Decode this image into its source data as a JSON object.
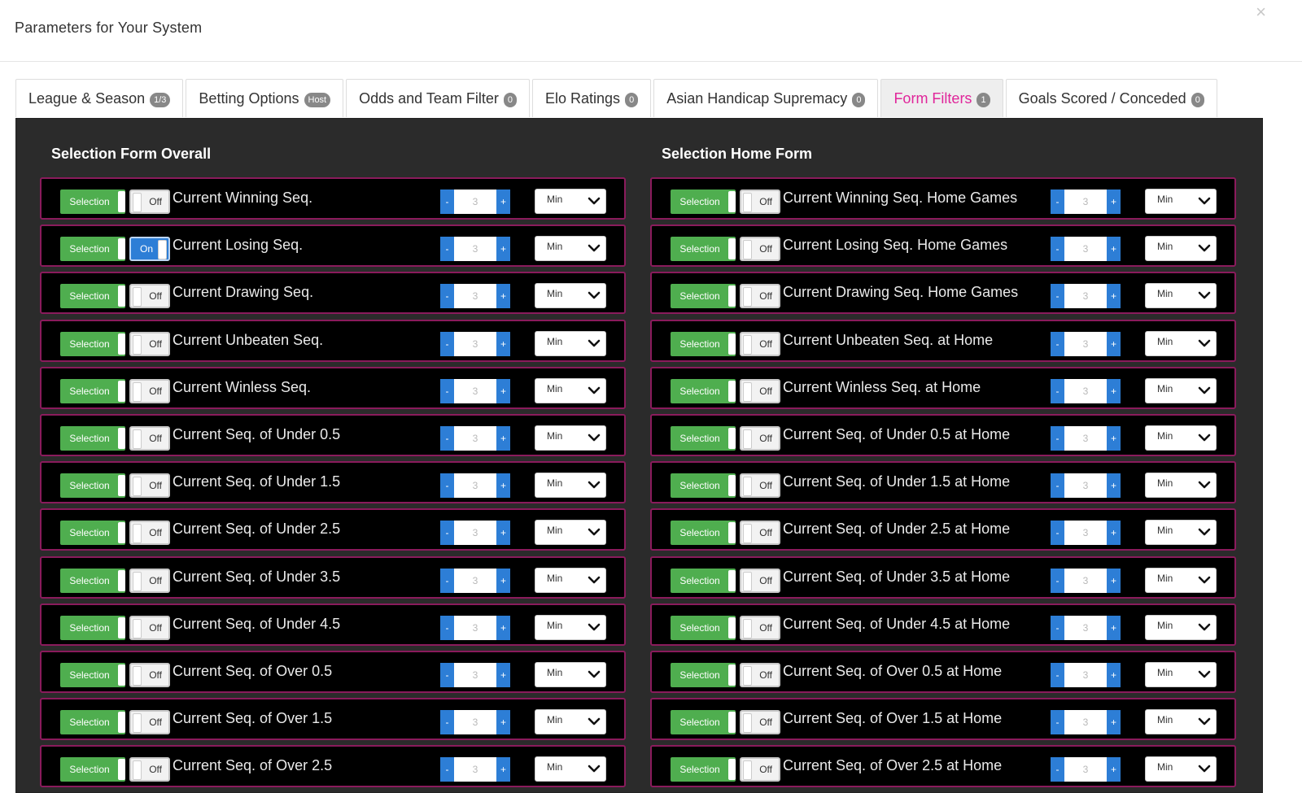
{
  "modal": {
    "title": "Parameters for Your System",
    "close": "×"
  },
  "tabs": [
    {
      "label": "League & Season",
      "badge": "1/3"
    },
    {
      "label": "Betting Options",
      "badge": "Host"
    },
    {
      "label": "Odds and Team Filter",
      "badge": "0"
    },
    {
      "label": "Elo Ratings",
      "badge": "0"
    },
    {
      "label": "Asian Handicap Supremacy",
      "badge": "0"
    },
    {
      "label": "Form Filters",
      "badge": "1",
      "active": true
    },
    {
      "label": "Goals Scored / Conceded",
      "badge": "0"
    }
  ],
  "left": {
    "title": "Selection Form Overall",
    "rows": [
      {
        "sel": "Selection",
        "toggle": "Off",
        "label": "Current Winning Seq.",
        "minus": "-",
        "value": "3",
        "plus": "+",
        "select": "Min"
      },
      {
        "sel": "Selection",
        "toggle": "On",
        "label": "Current Losing Seq.",
        "minus": "-",
        "value": "3",
        "plus": "+",
        "select": "Min"
      },
      {
        "sel": "Selection",
        "toggle": "Off",
        "label": "Current Drawing Seq.",
        "minus": "-",
        "value": "3",
        "plus": "+",
        "select": "Min"
      },
      {
        "sel": "Selection",
        "toggle": "Off",
        "label": "Current Unbeaten Seq.",
        "minus": "-",
        "value": "3",
        "plus": "+",
        "select": "Min"
      },
      {
        "sel": "Selection",
        "toggle": "Off",
        "label": "Current Winless Seq.",
        "minus": "-",
        "value": "3",
        "plus": "+",
        "select": "Min"
      },
      {
        "sel": "Selection",
        "toggle": "Off",
        "label": "Current Seq. of Under 0.5",
        "minus": "-",
        "value": "3",
        "plus": "+",
        "select": "Min"
      },
      {
        "sel": "Selection",
        "toggle": "Off",
        "label": "Current Seq. of Under 1.5",
        "minus": "-",
        "value": "3",
        "plus": "+",
        "select": "Min"
      },
      {
        "sel": "Selection",
        "toggle": "Off",
        "label": "Current Seq. of Under 2.5",
        "minus": "-",
        "value": "3",
        "plus": "+",
        "select": "Min"
      },
      {
        "sel": "Selection",
        "toggle": "Off",
        "label": "Current Seq. of Under 3.5",
        "minus": "-",
        "value": "3",
        "plus": "+",
        "select": "Min"
      },
      {
        "sel": "Selection",
        "toggle": "Off",
        "label": "Current Seq. of Under 4.5",
        "minus": "-",
        "value": "3",
        "plus": "+",
        "select": "Min"
      },
      {
        "sel": "Selection",
        "toggle": "Off",
        "label": "Current Seq. of Over 0.5",
        "minus": "-",
        "value": "3",
        "plus": "+",
        "select": "Min"
      },
      {
        "sel": "Selection",
        "toggle": "Off",
        "label": "Current Seq. of Over 1.5",
        "minus": "-",
        "value": "3",
        "plus": "+",
        "select": "Min"
      },
      {
        "sel": "Selection",
        "toggle": "Off",
        "label": "Current Seq. of Over 2.5",
        "minus": "-",
        "value": "3",
        "plus": "+",
        "select": "Min"
      }
    ]
  },
  "right": {
    "title": "Selection Home Form",
    "rows": [
      {
        "sel": "Selection",
        "toggle": "Off",
        "label": "Current Winning Seq. Home Games",
        "minus": "-",
        "value": "3",
        "plus": "+",
        "select": "Min"
      },
      {
        "sel": "Selection",
        "toggle": "Off",
        "label": "Current Losing Seq. Home Games",
        "minus": "-",
        "value": "3",
        "plus": "+",
        "select": "Min"
      },
      {
        "sel": "Selection",
        "toggle": "Off",
        "label": "Current Drawing Seq. Home Games",
        "minus": "-",
        "value": "3",
        "plus": "+",
        "select": "Min"
      },
      {
        "sel": "Selection",
        "toggle": "Off",
        "label": "Current Unbeaten Seq. at Home",
        "minus": "-",
        "value": "3",
        "plus": "+",
        "select": "Min"
      },
      {
        "sel": "Selection",
        "toggle": "Off",
        "label": "Current Winless Seq. at Home",
        "minus": "-",
        "value": "3",
        "plus": "+",
        "select": "Min"
      },
      {
        "sel": "Selection",
        "toggle": "Off",
        "label": "Current Seq. of Under 0.5 at Home",
        "minus": "-",
        "value": "3",
        "plus": "+",
        "select": "Min"
      },
      {
        "sel": "Selection",
        "toggle": "Off",
        "label": "Current Seq. of Under 1.5 at Home",
        "minus": "-",
        "value": "3",
        "plus": "+",
        "select": "Min"
      },
      {
        "sel": "Selection",
        "toggle": "Off",
        "label": "Current Seq. of Under 2.5 at Home",
        "minus": "-",
        "value": "3",
        "plus": "+",
        "select": "Min"
      },
      {
        "sel": "Selection",
        "toggle": "Off",
        "label": "Current Seq. of Under 3.5 at Home",
        "minus": "-",
        "value": "3",
        "plus": "+",
        "select": "Min"
      },
      {
        "sel": "Selection",
        "toggle": "Off",
        "label": "Current Seq. of Under 4.5 at Home",
        "minus": "-",
        "value": "3",
        "plus": "+",
        "select": "Min"
      },
      {
        "sel": "Selection",
        "toggle": "Off",
        "label": "Current Seq. of Over 0.5 at Home",
        "minus": "-",
        "value": "3",
        "plus": "+",
        "select": "Min"
      },
      {
        "sel": "Selection",
        "toggle": "Off",
        "label": "Current Seq. of Over 1.5 at Home",
        "minus": "-",
        "value": "3",
        "plus": "+",
        "select": "Min"
      },
      {
        "sel": "Selection",
        "toggle": "Off",
        "label": "Current Seq. of Over 2.5 at Home",
        "minus": "-",
        "value": "3",
        "plus": "+",
        "select": "Min"
      }
    ]
  },
  "colors": {
    "accent": "#e0259a",
    "selection_green": "#4fae4f",
    "toggle_on_blue": "#2d7ed6",
    "panel_bg": "#2b2b2b",
    "row_border": "#8a1b5c"
  },
  "icons": {
    "close": "close-icon",
    "dropdown": "chevron-down-icon"
  }
}
